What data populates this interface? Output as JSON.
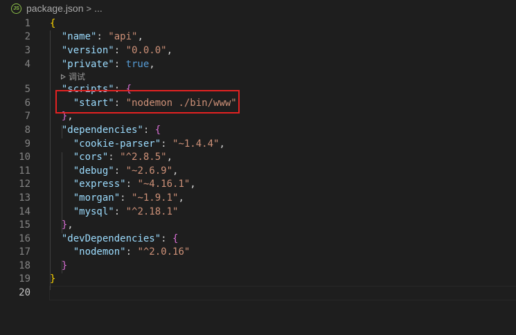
{
  "breadcrumb": {
    "file_icon_text": "JS",
    "file_name": "package.json",
    "separator": ">",
    "more": "..."
  },
  "codelens": {
    "label": "调试"
  },
  "lines": [
    {
      "n": "1",
      "parts": [
        {
          "t": "{",
          "c": "b1"
        }
      ]
    },
    {
      "n": "2",
      "parts": [
        {
          "t": "  "
        },
        {
          "t": "\"name\"",
          "c": "key"
        },
        {
          "t": ": "
        },
        {
          "t": "\"api\"",
          "c": "str"
        },
        {
          "t": ","
        }
      ]
    },
    {
      "n": "3",
      "parts": [
        {
          "t": "  "
        },
        {
          "t": "\"version\"",
          "c": "key"
        },
        {
          "t": ": "
        },
        {
          "t": "\"0.0.0\"",
          "c": "str"
        },
        {
          "t": ","
        }
      ]
    },
    {
      "n": "4",
      "parts": [
        {
          "t": "  "
        },
        {
          "t": "\"private\"",
          "c": "key"
        },
        {
          "t": ": "
        },
        {
          "t": "true",
          "c": "kw"
        },
        {
          "t": ","
        }
      ]
    },
    {
      "n": "5",
      "parts": [
        {
          "t": "  "
        },
        {
          "t": "\"scripts\"",
          "c": "key"
        },
        {
          "t": ": "
        },
        {
          "t": "{",
          "c": "b2"
        }
      ]
    },
    {
      "n": "6",
      "parts": [
        {
          "t": "    "
        },
        {
          "t": "\"start\"",
          "c": "key"
        },
        {
          "t": ": "
        },
        {
          "t": "\"nodemon ./bin/www\"",
          "c": "str"
        }
      ]
    },
    {
      "n": "7",
      "parts": [
        {
          "t": "  "
        },
        {
          "t": "}",
          "c": "b2"
        },
        {
          "t": ","
        }
      ]
    },
    {
      "n": "8",
      "parts": [
        {
          "t": "  "
        },
        {
          "t": "\"dependencies\"",
          "c": "key"
        },
        {
          "t": ": "
        },
        {
          "t": "{",
          "c": "b2"
        }
      ]
    },
    {
      "n": "9",
      "parts": [
        {
          "t": "    "
        },
        {
          "t": "\"cookie-parser\"",
          "c": "key"
        },
        {
          "t": ": "
        },
        {
          "t": "\"~1.4.4\"",
          "c": "str"
        },
        {
          "t": ","
        }
      ]
    },
    {
      "n": "10",
      "parts": [
        {
          "t": "    "
        },
        {
          "t": "\"cors\"",
          "c": "key"
        },
        {
          "t": ": "
        },
        {
          "t": "\"^2.8.5\"",
          "c": "str"
        },
        {
          "t": ","
        }
      ]
    },
    {
      "n": "11",
      "parts": [
        {
          "t": "    "
        },
        {
          "t": "\"debug\"",
          "c": "key"
        },
        {
          "t": ": "
        },
        {
          "t": "\"~2.6.9\"",
          "c": "str"
        },
        {
          "t": ","
        }
      ]
    },
    {
      "n": "12",
      "parts": [
        {
          "t": "    "
        },
        {
          "t": "\"express\"",
          "c": "key"
        },
        {
          "t": ": "
        },
        {
          "t": "\"~4.16.1\"",
          "c": "str"
        },
        {
          "t": ","
        }
      ]
    },
    {
      "n": "13",
      "parts": [
        {
          "t": "    "
        },
        {
          "t": "\"morgan\"",
          "c": "key"
        },
        {
          "t": ": "
        },
        {
          "t": "\"~1.9.1\"",
          "c": "str"
        },
        {
          "t": ","
        }
      ]
    },
    {
      "n": "14",
      "parts": [
        {
          "t": "    "
        },
        {
          "t": "\"mysql\"",
          "c": "key"
        },
        {
          "t": ": "
        },
        {
          "t": "\"^2.18.1\"",
          "c": "str"
        }
      ]
    },
    {
      "n": "15",
      "parts": [
        {
          "t": "  "
        },
        {
          "t": "}",
          "c": "b2"
        },
        {
          "t": ","
        }
      ]
    },
    {
      "n": "16",
      "parts": [
        {
          "t": "  "
        },
        {
          "t": "\"devDependencies\"",
          "c": "key"
        },
        {
          "t": ": "
        },
        {
          "t": "{",
          "c": "b2"
        }
      ]
    },
    {
      "n": "17",
      "parts": [
        {
          "t": "    "
        },
        {
          "t": "\"nodemon\"",
          "c": "key"
        },
        {
          "t": ": "
        },
        {
          "t": "\"^2.0.16\"",
          "c": "str"
        }
      ]
    },
    {
      "n": "18",
      "parts": [
        {
          "t": "  "
        },
        {
          "t": "}",
          "c": "b2"
        }
      ]
    },
    {
      "n": "19",
      "parts": [
        {
          "t": "}",
          "c": "b1"
        }
      ]
    },
    {
      "n": "20",
      "parts": []
    }
  ],
  "active_line": "20"
}
